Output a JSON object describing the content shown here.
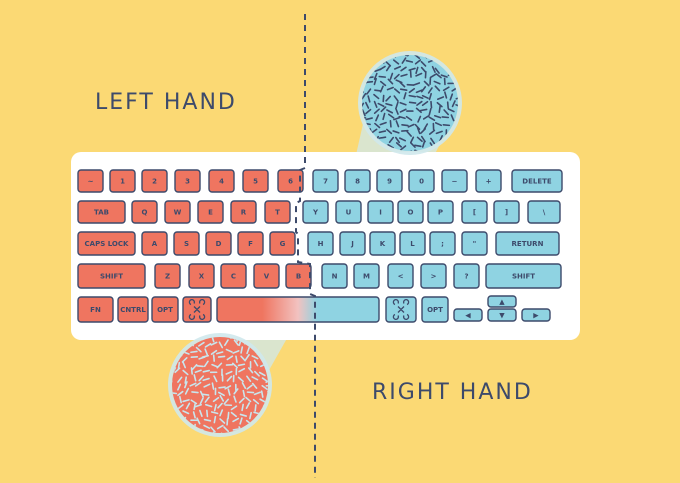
{
  "labels": {
    "left": "LEFT HAND",
    "right": "RIGHT HAND"
  },
  "colors": {
    "background": "#fbd974",
    "keyboard_body": "#ffffff",
    "left_keys": "#ef7560",
    "right_keys": "#8fd3e2",
    "ink": "#3d4a6b",
    "divider": "#3d4a6b"
  },
  "icons": {
    "command_key": "command-icon"
  },
  "keyboard": {
    "rows": [
      {
        "keys": [
          {
            "label": "~",
            "side": "left"
          },
          {
            "label": "1",
            "side": "left"
          },
          {
            "label": "2",
            "side": "left"
          },
          {
            "label": "3",
            "side": "left"
          },
          {
            "label": "4",
            "side": "left"
          },
          {
            "label": "5",
            "side": "left"
          },
          {
            "label": "6",
            "side": "left"
          },
          {
            "label": "7",
            "side": "right"
          },
          {
            "label": "8",
            "side": "right"
          },
          {
            "label": "9",
            "side": "right"
          },
          {
            "label": "0",
            "side": "right"
          },
          {
            "label": "−",
            "side": "right"
          },
          {
            "label": "+",
            "side": "right"
          },
          {
            "label": "DELETE",
            "side": "right"
          }
        ]
      },
      {
        "keys": [
          {
            "label": "TAB",
            "side": "left"
          },
          {
            "label": "Q",
            "side": "left"
          },
          {
            "label": "W",
            "side": "left"
          },
          {
            "label": "E",
            "side": "left"
          },
          {
            "label": "R",
            "side": "left"
          },
          {
            "label": "T",
            "side": "left"
          },
          {
            "label": "Y",
            "side": "right"
          },
          {
            "label": "U",
            "side": "right"
          },
          {
            "label": "I",
            "side": "right"
          },
          {
            "label": "O",
            "side": "right"
          },
          {
            "label": "P",
            "side": "right"
          },
          {
            "label": "[",
            "side": "right"
          },
          {
            "label": "]",
            "side": "right"
          },
          {
            "label": "\\",
            "side": "right"
          }
        ]
      },
      {
        "keys": [
          {
            "label": "CAPS LOCK",
            "side": "left"
          },
          {
            "label": "A",
            "side": "left"
          },
          {
            "label": "S",
            "side": "left"
          },
          {
            "label": "D",
            "side": "left"
          },
          {
            "label": "F",
            "side": "left"
          },
          {
            "label": "G",
            "side": "left"
          },
          {
            "label": "H",
            "side": "right"
          },
          {
            "label": "J",
            "side": "right"
          },
          {
            "label": "K",
            "side": "right"
          },
          {
            "label": "L",
            "side": "right"
          },
          {
            "label": ";",
            "side": "right"
          },
          {
            "label": "\"",
            "side": "right"
          },
          {
            "label": "RETURN",
            "side": "right"
          }
        ]
      },
      {
        "keys": [
          {
            "label": "SHIFT",
            "side": "left"
          },
          {
            "label": "Z",
            "side": "left"
          },
          {
            "label": "X",
            "side": "left"
          },
          {
            "label": "C",
            "side": "left"
          },
          {
            "label": "V",
            "side": "left"
          },
          {
            "label": "B",
            "side": "left"
          },
          {
            "label": "N",
            "side": "right"
          },
          {
            "label": "M",
            "side": "right"
          },
          {
            "label": "<",
            "side": "right"
          },
          {
            "label": ">",
            "side": "right"
          },
          {
            "label": "?",
            "side": "right"
          },
          {
            "label": "SHIFT",
            "side": "right"
          }
        ]
      },
      {
        "keys": [
          {
            "label": "FN",
            "side": "left"
          },
          {
            "label": "CNTRL",
            "side": "left"
          },
          {
            "label": "OPT",
            "side": "left"
          },
          {
            "label": "",
            "side": "left",
            "icon": "command-icon"
          },
          {
            "label": "",
            "side": "split"
          },
          {
            "label": "",
            "side": "right",
            "icon": "command-icon"
          },
          {
            "label": "OPT",
            "side": "right"
          },
          {
            "label": "◀",
            "side": "right"
          },
          {
            "label": "▲",
            "side": "right"
          },
          {
            "label": "▼",
            "side": "right"
          },
          {
            "label": "▶",
            "side": "right"
          }
        ]
      }
    ]
  }
}
